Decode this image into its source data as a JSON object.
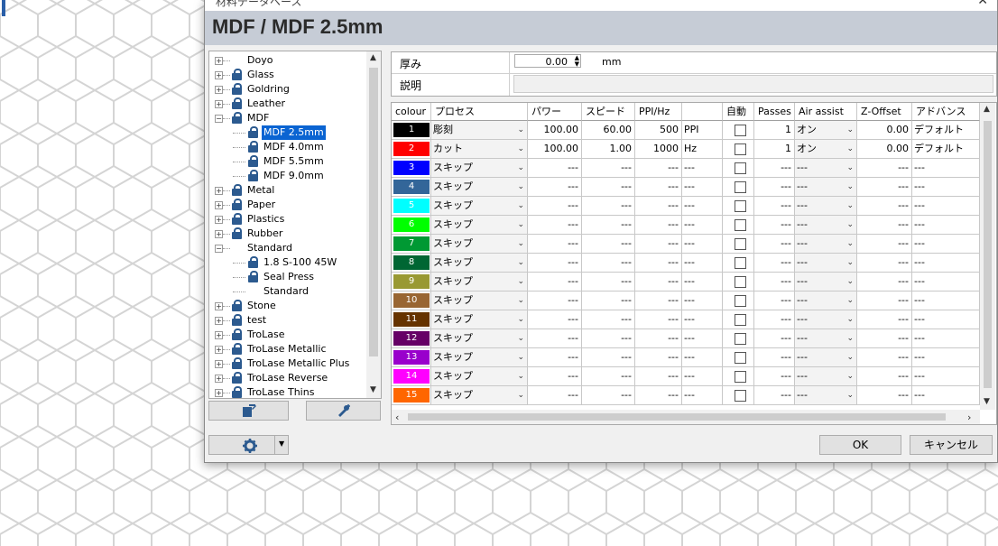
{
  "window": {
    "title": "材料データベース",
    "heading": "MDF / MDF 2.5mm"
  },
  "tree": {
    "items": [
      {
        "label": "Doyo",
        "level": 0,
        "expander": "+",
        "locked": false
      },
      {
        "label": "Glass",
        "level": 0,
        "expander": "+",
        "locked": true
      },
      {
        "label": "Goldring",
        "level": 0,
        "expander": "+",
        "locked": true
      },
      {
        "label": "Leather",
        "level": 0,
        "expander": "+",
        "locked": true
      },
      {
        "label": "MDF",
        "level": 0,
        "expander": "-",
        "locked": true
      },
      {
        "label": "MDF 2.5mm",
        "level": 1,
        "expander": "",
        "locked": true,
        "selected": true
      },
      {
        "label": "MDF 4.0mm",
        "level": 1,
        "expander": "",
        "locked": true
      },
      {
        "label": "MDF 5.5mm",
        "level": 1,
        "expander": "",
        "locked": true
      },
      {
        "label": "MDF 9.0mm",
        "level": 1,
        "expander": "",
        "locked": true
      },
      {
        "label": "Metal",
        "level": 0,
        "expander": "+",
        "locked": true
      },
      {
        "label": "Paper",
        "level": 0,
        "expander": "+",
        "locked": true
      },
      {
        "label": "Plastics",
        "level": 0,
        "expander": "+",
        "locked": true
      },
      {
        "label": "Rubber",
        "level": 0,
        "expander": "+",
        "locked": true
      },
      {
        "label": "Standard",
        "level": 0,
        "expander": "-",
        "locked": false
      },
      {
        "label": "1.8 S-100 45W",
        "level": 1,
        "expander": "",
        "locked": true
      },
      {
        "label": "Seal Press",
        "level": 1,
        "expander": "",
        "locked": true
      },
      {
        "label": "Standard",
        "level": 1,
        "expander": "",
        "locked": false
      },
      {
        "label": "Stone",
        "level": 0,
        "expander": "+",
        "locked": true
      },
      {
        "label": "test",
        "level": 0,
        "expander": "+",
        "locked": true
      },
      {
        "label": "TroLase",
        "level": 0,
        "expander": "+",
        "locked": true
      },
      {
        "label": "TroLase Metallic",
        "level": 0,
        "expander": "+",
        "locked": true
      },
      {
        "label": "TroLase Metallic Plus",
        "level": 0,
        "expander": "+",
        "locked": true
      },
      {
        "label": "TroLase Reverse",
        "level": 0,
        "expander": "+",
        "locked": true
      },
      {
        "label": "TroLase Thins",
        "level": 0,
        "expander": "+",
        "locked": true
      }
    ]
  },
  "properties": {
    "thickness_label": "厚み",
    "thickness_value": "0.00",
    "thickness_unit": "mm",
    "description_label": "説明",
    "description_value": ""
  },
  "grid": {
    "columns": [
      "colour",
      "プロセス",
      "パワー",
      "スピード",
      "PPI/Hz",
      "",
      "自動",
      "Passes",
      "Air assist",
      "Z-Offset",
      "アドバンス"
    ],
    "rows": [
      {
        "num": "1",
        "color": "#000000",
        "process": "彫刻",
        "power": "100.00",
        "speed": "60.00",
        "ppi": "500",
        "unit": "PPI",
        "auto": false,
        "passes": "1",
        "air": "オン",
        "z": "0.00",
        "adv": "デフォルト"
      },
      {
        "num": "2",
        "color": "#ff0000",
        "process": "カット",
        "power": "100.00",
        "speed": "1.00",
        "ppi": "1000",
        "unit": "Hz",
        "auto": false,
        "passes": "1",
        "air": "オン",
        "z": "0.00",
        "adv": "デフォルト"
      },
      {
        "num": "3",
        "color": "#0000ff",
        "process": "スキップ",
        "power": "---",
        "speed": "---",
        "ppi": "---",
        "unit": "---",
        "auto": false,
        "passes": "---",
        "air": "---",
        "z": "---",
        "adv": "---"
      },
      {
        "num": "4",
        "color": "#336699",
        "process": "スキップ",
        "power": "---",
        "speed": "---",
        "ppi": "---",
        "unit": "---",
        "auto": false,
        "passes": "---",
        "air": "---",
        "z": "---",
        "adv": "---"
      },
      {
        "num": "5",
        "color": "#00ffff",
        "process": "スキップ",
        "power": "---",
        "speed": "---",
        "ppi": "---",
        "unit": "---",
        "auto": false,
        "passes": "---",
        "air": "---",
        "z": "---",
        "adv": "---"
      },
      {
        "num": "6",
        "color": "#00ff00",
        "process": "スキップ",
        "power": "---",
        "speed": "---",
        "ppi": "---",
        "unit": "---",
        "auto": false,
        "passes": "---",
        "air": "---",
        "z": "---",
        "adv": "---"
      },
      {
        "num": "7",
        "color": "#009933",
        "process": "スキップ",
        "power": "---",
        "speed": "---",
        "ppi": "---",
        "unit": "---",
        "auto": false,
        "passes": "---",
        "air": "---",
        "z": "---",
        "adv": "---"
      },
      {
        "num": "8",
        "color": "#006633",
        "process": "スキップ",
        "power": "---",
        "speed": "---",
        "ppi": "---",
        "unit": "---",
        "auto": false,
        "passes": "---",
        "air": "---",
        "z": "---",
        "adv": "---"
      },
      {
        "num": "9",
        "color": "#999933",
        "process": "スキップ",
        "power": "---",
        "speed": "---",
        "ppi": "---",
        "unit": "---",
        "auto": false,
        "passes": "---",
        "air": "---",
        "z": "---",
        "adv": "---"
      },
      {
        "num": "10",
        "color": "#996633",
        "process": "スキップ",
        "power": "---",
        "speed": "---",
        "ppi": "---",
        "unit": "---",
        "auto": false,
        "passes": "---",
        "air": "---",
        "z": "---",
        "adv": "---"
      },
      {
        "num": "11",
        "color": "#663300",
        "process": "スキップ",
        "power": "---",
        "speed": "---",
        "ppi": "---",
        "unit": "---",
        "auto": false,
        "passes": "---",
        "air": "---",
        "z": "---",
        "adv": "---"
      },
      {
        "num": "12",
        "color": "#660066",
        "process": "スキップ",
        "power": "---",
        "speed": "---",
        "ppi": "---",
        "unit": "---",
        "auto": false,
        "passes": "---",
        "air": "---",
        "z": "---",
        "adv": "---"
      },
      {
        "num": "13",
        "color": "#9900cc",
        "process": "スキップ",
        "power": "---",
        "speed": "---",
        "ppi": "---",
        "unit": "---",
        "auto": false,
        "passes": "---",
        "air": "---",
        "z": "---",
        "adv": "---"
      },
      {
        "num": "14",
        "color": "#ff00ff",
        "process": "スキップ",
        "power": "---",
        "speed": "---",
        "ppi": "---",
        "unit": "---",
        "auto": false,
        "passes": "---",
        "air": "---",
        "z": "---",
        "adv": "---"
      },
      {
        "num": "15",
        "color": "#ff6600",
        "process": "スキップ",
        "power": "---",
        "speed": "---",
        "ppi": "---",
        "unit": "---",
        "auto": false,
        "passes": "---",
        "air": "---",
        "z": "---",
        "adv": "---"
      }
    ]
  },
  "buttons": {
    "ok": "OK",
    "cancel": "キャンセル"
  },
  "colors": {
    "selection": "#0a64d2",
    "header_band": "#c6ccd6",
    "lock_icon": "#2c5a8f"
  }
}
